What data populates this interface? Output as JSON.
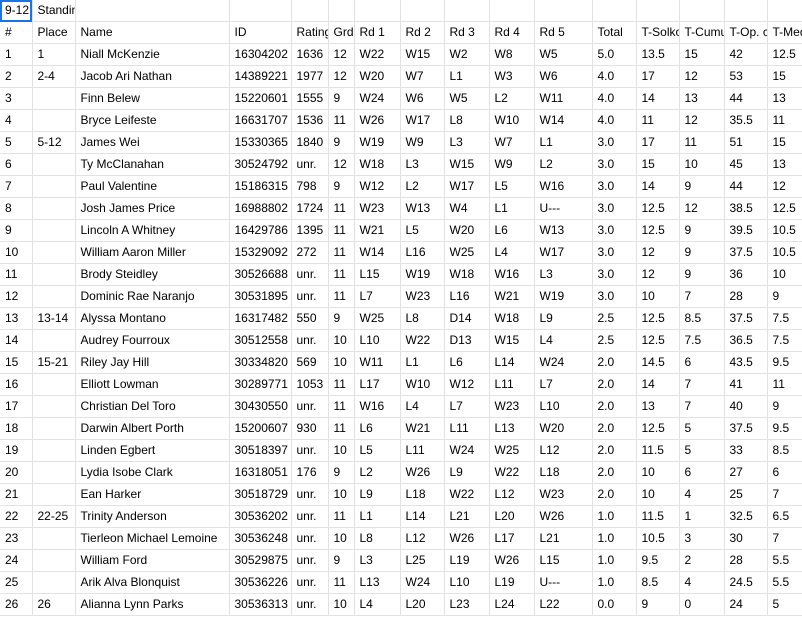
{
  "title": {
    "col_a": "9-12",
    "col_b": "Standings"
  },
  "headers": [
    "#",
    "Place",
    "Name",
    "ID",
    "Rating",
    "Grd",
    "Rd 1",
    "Rd 2",
    "Rd 3",
    "Rd 4",
    "Rd 5",
    "Total",
    "T-Solkoff",
    "T-Cumulative",
    "T-Op. cum",
    "T-Med"
  ],
  "rows": [
    [
      "1",
      "1",
      "Niall McKenzie",
      "16304202",
      "1636",
      "12",
      "W22",
      "W15",
      "W2",
      "W8",
      "W5",
      "5.0",
      "13.5",
      "15",
      "42",
      "12.5"
    ],
    [
      "2",
      "2-4",
      "Jacob Ari Nathan",
      "14389221",
      "1977",
      "12",
      "W20",
      "W7",
      "L1",
      "W3",
      "W6",
      "4.0",
      "17",
      "12",
      "53",
      "15"
    ],
    [
      "3",
      "",
      "Finn Belew",
      "15220601",
      "1555",
      "9",
      "W24",
      "W6",
      "W5",
      "L2",
      "W11",
      "4.0",
      "14",
      "13",
      "44",
      "13"
    ],
    [
      "4",
      "",
      "Bryce Leifeste",
      "16631707",
      "1536",
      "11",
      "W26",
      "W17",
      "L8",
      "W10",
      "W14",
      "4.0",
      "11",
      "12",
      "35.5",
      "11"
    ],
    [
      "5",
      "5-12",
      "James Wei",
      "15330365",
      "1840",
      "9",
      "W19",
      "W9",
      "L3",
      "W7",
      "L1",
      "3.0",
      "17",
      "11",
      "51",
      "15"
    ],
    [
      "6",
      "",
      "Ty McClanahan",
      "30524792",
      "unr.",
      "12",
      "W18",
      "L3",
      "W15",
      "W9",
      "L2",
      "3.0",
      "15",
      "10",
      "45",
      "13"
    ],
    [
      "7",
      "",
      "Paul Valentine",
      "15186315",
      "798",
      "9",
      "W12",
      "L2",
      "W17",
      "L5",
      "W16",
      "3.0",
      "14",
      "9",
      "44",
      "12"
    ],
    [
      "8",
      "",
      "Josh James Price",
      "16988802",
      "1724",
      "11",
      "W23",
      "W13",
      "W4",
      "L1",
      "U---",
      "3.0",
      "12.5",
      "12",
      "38.5",
      "12.5"
    ],
    [
      "9",
      "",
      "Lincoln A Whitney",
      "16429786",
      "1395",
      "11",
      "W21",
      "L5",
      "W20",
      "L6",
      "W13",
      "3.0",
      "12.5",
      "9",
      "39.5",
      "10.5"
    ],
    [
      "10",
      "",
      "William Aaron Miller",
      "15329092",
      "272",
      "11",
      "W14",
      "L16",
      "W25",
      "L4",
      "W17",
      "3.0",
      "12",
      "9",
      "37.5",
      "10.5"
    ],
    [
      "11",
      "",
      "Brody Steidley",
      "30526688",
      "unr.",
      "11",
      "L15",
      "W19",
      "W18",
      "W16",
      "L3",
      "3.0",
      "12",
      "9",
      "36",
      "10"
    ],
    [
      "12",
      "",
      "Dominic Rae Naranjo",
      "30531895",
      "unr.",
      "11",
      "L7",
      "W23",
      "L16",
      "W21",
      "W19",
      "3.0",
      "10",
      "7",
      "28",
      "9"
    ],
    [
      "13",
      "13-14",
      "Alyssa Montano",
      "16317482",
      "550",
      "9",
      "W25",
      "L8",
      "D14",
      "W18",
      "L9",
      "2.5",
      "12.5",
      "8.5",
      "37.5",
      "7.5"
    ],
    [
      "14",
      "",
      "Audrey Fourroux",
      "30512558",
      "unr.",
      "10",
      "L10",
      "W22",
      "D13",
      "W15",
      "L4",
      "2.5",
      "12.5",
      "7.5",
      "36.5",
      "7.5"
    ],
    [
      "15",
      "15-21",
      "Riley Jay Hill",
      "30334820",
      "569",
      "10",
      "W11",
      "L1",
      "L6",
      "L14",
      "W24",
      "2.0",
      "14.5",
      "6",
      "43.5",
      "9.5"
    ],
    [
      "16",
      "",
      "Elliott Lowman",
      "30289771",
      "1053",
      "11",
      "L17",
      "W10",
      "W12",
      "L11",
      "L7",
      "2.0",
      "14",
      "7",
      "41",
      "11"
    ],
    [
      "17",
      "",
      "Christian Del Toro",
      "30430550",
      "unr.",
      "11",
      "W16",
      "L4",
      "L7",
      "W23",
      "L10",
      "2.0",
      "13",
      "7",
      "40",
      "9"
    ],
    [
      "18",
      "",
      "Darwin Albert Porth",
      "15200607",
      "930",
      "11",
      "L6",
      "W21",
      "L11",
      "L13",
      "W20",
      "2.0",
      "12.5",
      "5",
      "37.5",
      "9.5"
    ],
    [
      "19",
      "",
      "Linden Egbert",
      "30518397",
      "unr.",
      "10",
      "L5",
      "L11",
      "W24",
      "W25",
      "L12",
      "2.0",
      "11.5",
      "5",
      "33",
      "8.5"
    ],
    [
      "20",
      "",
      "Lydia Isobe Clark",
      "16318051",
      "176",
      "9",
      "L2",
      "W26",
      "L9",
      "W22",
      "L18",
      "2.0",
      "10",
      "6",
      "27",
      "6"
    ],
    [
      "21",
      "",
      "Ean Harker",
      "30518729",
      "unr.",
      "10",
      "L9",
      "L18",
      "W22",
      "L12",
      "W23",
      "2.0",
      "10",
      "4",
      "25",
      "7"
    ],
    [
      "22",
      "22-25",
      "Trinity Anderson",
      "30536202",
      "unr.",
      "11",
      "L1",
      "L14",
      "L21",
      "L20",
      "W26",
      "1.0",
      "11.5",
      "1",
      "32.5",
      "6.5"
    ],
    [
      "23",
      "",
      "Tierleon Michael Lemoine",
      "30536248",
      "unr.",
      "10",
      "L8",
      "L12",
      "W26",
      "L17",
      "L21",
      "1.0",
      "10.5",
      "3",
      "30",
      "7"
    ],
    [
      "24",
      "",
      "William Ford",
      "30529875",
      "unr.",
      "9",
      "L3",
      "L25",
      "L19",
      "W26",
      "L15",
      "1.0",
      "9.5",
      "2",
      "28",
      "5.5"
    ],
    [
      "25",
      "",
      "Arik Alva Blonquist",
      "30536226",
      "unr.",
      "11",
      "L13",
      "W24",
      "L10",
      "L19",
      "U---",
      "1.0",
      "8.5",
      "4",
      "24.5",
      "5.5"
    ],
    [
      "26",
      "26",
      "Alianna Lynn Parks",
      "30536313",
      "unr.",
      "10",
      "L4",
      "L20",
      "L23",
      "L24",
      "L22",
      "0.0",
      "9",
      "0",
      "24",
      "5"
    ]
  ]
}
